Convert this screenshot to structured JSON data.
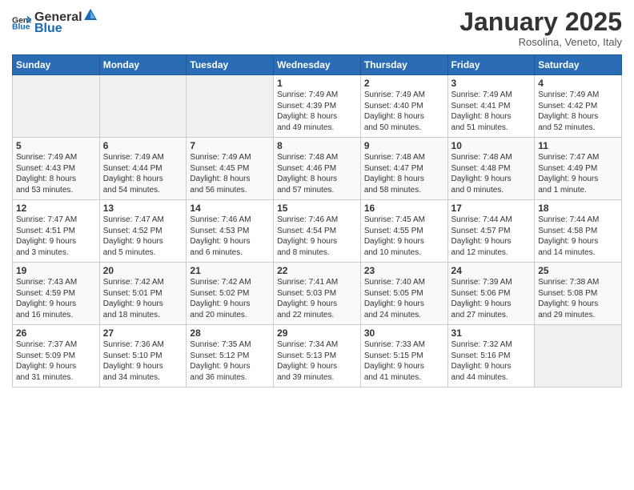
{
  "header": {
    "logo_general": "General",
    "logo_blue": "Blue",
    "month_title": "January 2025",
    "subtitle": "Rosolina, Veneto, Italy"
  },
  "weekdays": [
    "Sunday",
    "Monday",
    "Tuesday",
    "Wednesday",
    "Thursday",
    "Friday",
    "Saturday"
  ],
  "weeks": [
    [
      {
        "day": "",
        "info": ""
      },
      {
        "day": "",
        "info": ""
      },
      {
        "day": "",
        "info": ""
      },
      {
        "day": "1",
        "info": "Sunrise: 7:49 AM\nSunset: 4:39 PM\nDaylight: 8 hours\nand 49 minutes."
      },
      {
        "day": "2",
        "info": "Sunrise: 7:49 AM\nSunset: 4:40 PM\nDaylight: 8 hours\nand 50 minutes."
      },
      {
        "day": "3",
        "info": "Sunrise: 7:49 AM\nSunset: 4:41 PM\nDaylight: 8 hours\nand 51 minutes."
      },
      {
        "day": "4",
        "info": "Sunrise: 7:49 AM\nSunset: 4:42 PM\nDaylight: 8 hours\nand 52 minutes."
      }
    ],
    [
      {
        "day": "5",
        "info": "Sunrise: 7:49 AM\nSunset: 4:43 PM\nDaylight: 8 hours\nand 53 minutes."
      },
      {
        "day": "6",
        "info": "Sunrise: 7:49 AM\nSunset: 4:44 PM\nDaylight: 8 hours\nand 54 minutes."
      },
      {
        "day": "7",
        "info": "Sunrise: 7:49 AM\nSunset: 4:45 PM\nDaylight: 8 hours\nand 56 minutes."
      },
      {
        "day": "8",
        "info": "Sunrise: 7:48 AM\nSunset: 4:46 PM\nDaylight: 8 hours\nand 57 minutes."
      },
      {
        "day": "9",
        "info": "Sunrise: 7:48 AM\nSunset: 4:47 PM\nDaylight: 8 hours\nand 58 minutes."
      },
      {
        "day": "10",
        "info": "Sunrise: 7:48 AM\nSunset: 4:48 PM\nDaylight: 9 hours\nand 0 minutes."
      },
      {
        "day": "11",
        "info": "Sunrise: 7:47 AM\nSunset: 4:49 PM\nDaylight: 9 hours\nand 1 minute."
      }
    ],
    [
      {
        "day": "12",
        "info": "Sunrise: 7:47 AM\nSunset: 4:51 PM\nDaylight: 9 hours\nand 3 minutes."
      },
      {
        "day": "13",
        "info": "Sunrise: 7:47 AM\nSunset: 4:52 PM\nDaylight: 9 hours\nand 5 minutes."
      },
      {
        "day": "14",
        "info": "Sunrise: 7:46 AM\nSunset: 4:53 PM\nDaylight: 9 hours\nand 6 minutes."
      },
      {
        "day": "15",
        "info": "Sunrise: 7:46 AM\nSunset: 4:54 PM\nDaylight: 9 hours\nand 8 minutes."
      },
      {
        "day": "16",
        "info": "Sunrise: 7:45 AM\nSunset: 4:55 PM\nDaylight: 9 hours\nand 10 minutes."
      },
      {
        "day": "17",
        "info": "Sunrise: 7:44 AM\nSunset: 4:57 PM\nDaylight: 9 hours\nand 12 minutes."
      },
      {
        "day": "18",
        "info": "Sunrise: 7:44 AM\nSunset: 4:58 PM\nDaylight: 9 hours\nand 14 minutes."
      }
    ],
    [
      {
        "day": "19",
        "info": "Sunrise: 7:43 AM\nSunset: 4:59 PM\nDaylight: 9 hours\nand 16 minutes."
      },
      {
        "day": "20",
        "info": "Sunrise: 7:42 AM\nSunset: 5:01 PM\nDaylight: 9 hours\nand 18 minutes."
      },
      {
        "day": "21",
        "info": "Sunrise: 7:42 AM\nSunset: 5:02 PM\nDaylight: 9 hours\nand 20 minutes."
      },
      {
        "day": "22",
        "info": "Sunrise: 7:41 AM\nSunset: 5:03 PM\nDaylight: 9 hours\nand 22 minutes."
      },
      {
        "day": "23",
        "info": "Sunrise: 7:40 AM\nSunset: 5:05 PM\nDaylight: 9 hours\nand 24 minutes."
      },
      {
        "day": "24",
        "info": "Sunrise: 7:39 AM\nSunset: 5:06 PM\nDaylight: 9 hours\nand 27 minutes."
      },
      {
        "day": "25",
        "info": "Sunrise: 7:38 AM\nSunset: 5:08 PM\nDaylight: 9 hours\nand 29 minutes."
      }
    ],
    [
      {
        "day": "26",
        "info": "Sunrise: 7:37 AM\nSunset: 5:09 PM\nDaylight: 9 hours\nand 31 minutes."
      },
      {
        "day": "27",
        "info": "Sunrise: 7:36 AM\nSunset: 5:10 PM\nDaylight: 9 hours\nand 34 minutes."
      },
      {
        "day": "28",
        "info": "Sunrise: 7:35 AM\nSunset: 5:12 PM\nDaylight: 9 hours\nand 36 minutes."
      },
      {
        "day": "29",
        "info": "Sunrise: 7:34 AM\nSunset: 5:13 PM\nDaylight: 9 hours\nand 39 minutes."
      },
      {
        "day": "30",
        "info": "Sunrise: 7:33 AM\nSunset: 5:15 PM\nDaylight: 9 hours\nand 41 minutes."
      },
      {
        "day": "31",
        "info": "Sunrise: 7:32 AM\nSunset: 5:16 PM\nDaylight: 9 hours\nand 44 minutes."
      },
      {
        "day": "",
        "info": ""
      }
    ]
  ]
}
